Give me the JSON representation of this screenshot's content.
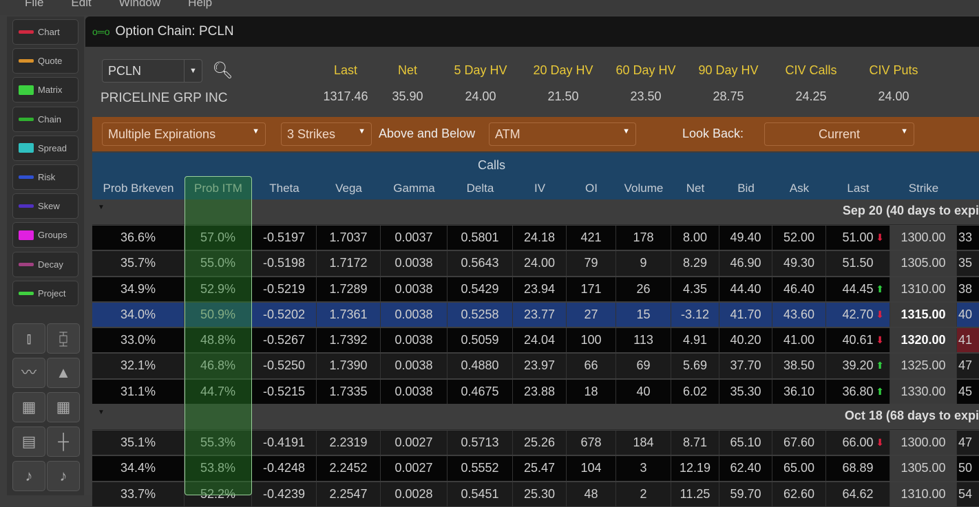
{
  "menu": [
    "File",
    "Edit",
    "Window",
    "Help"
  ],
  "sidebar": {
    "items": [
      {
        "label": "Chart",
        "icon": "chart-icon",
        "color": "#d02840"
      },
      {
        "label": "Quote",
        "icon": "quote-icon",
        "color": "#d8902a"
      },
      {
        "label": "Matrix",
        "icon": "matrix-icon",
        "color": "#3cd040"
      },
      {
        "label": "Chain",
        "icon": "chain-icon",
        "color": "#30b030"
      },
      {
        "label": "Spread",
        "icon": "spread-icon",
        "color": "#30c0c0"
      },
      {
        "label": "Risk",
        "icon": "risk-icon",
        "color": "#3050d0"
      },
      {
        "label": "Skew",
        "icon": "skew-icon",
        "color": "#5030c0"
      },
      {
        "label": "Groups",
        "icon": "groups-icon",
        "color": "#e020e0"
      },
      {
        "label": "Decay",
        "icon": "decay-icon",
        "color": "#a04080"
      },
      {
        "label": "Project",
        "icon": "project-icon",
        "color": "#40d040"
      }
    ]
  },
  "window": {
    "title": "Option Chain: PCLN"
  },
  "symbol": {
    "value": "PCLN",
    "company": "PRICELINE GRP INC"
  },
  "quote": {
    "headers": [
      "Last",
      "Net",
      "5 Day HV",
      "20 Day HV",
      "60 Day HV",
      "90 Day HV",
      "CIV Calls",
      "CIV Puts"
    ],
    "values": [
      "1317.46",
      "35.90",
      "24.00",
      "21.50",
      "23.50",
      "28.75",
      "24.25",
      "24.00"
    ]
  },
  "filters": {
    "expirations": "Multiple Expirations",
    "strikes": "3 Strikes",
    "above_below_label": "Above and Below",
    "atm": "ATM",
    "lookback_label": "Look Back:",
    "lookback": "Current"
  },
  "table": {
    "section": "Calls",
    "columns": [
      "Prob Brkeven",
      "Prob ITM",
      "Theta",
      "Vega",
      "Gamma",
      "Delta",
      "IV",
      "OI",
      "Volume",
      "Net",
      "Bid",
      "Ask",
      "Last",
      "Strike"
    ],
    "groups": [
      {
        "label": "Sep 20 (40 days to expi",
        "rows": [
          {
            "cells": [
              "36.6%",
              "57.0%",
              "-0.5197",
              "1.7037",
              "0.0037",
              "0.5801",
              "24.18",
              "421",
              "178",
              "8.00",
              "49.40",
              "52.00",
              "51.00",
              "1300.00",
              "33"
            ],
            "tick": "down"
          },
          {
            "cells": [
              "35.7%",
              "55.0%",
              "-0.5198",
              "1.7172",
              "0.0038",
              "0.5643",
              "24.00",
              "79",
              "9",
              "8.29",
              "46.90",
              "49.30",
              "51.50",
              "1305.00",
              "35"
            ],
            "tick": ""
          },
          {
            "cells": [
              "34.9%",
              "52.9%",
              "-0.5219",
              "1.7289",
              "0.0038",
              "0.5429",
              "23.94",
              "171",
              "26",
              "4.35",
              "44.40",
              "46.40",
              "44.45",
              "1310.00",
              "38"
            ],
            "tick": "up"
          },
          {
            "cells": [
              "34.0%",
              "50.9%",
              "-0.5202",
              "1.7361",
              "0.0038",
              "0.5258",
              "23.77",
              "27",
              "15",
              "-3.12",
              "41.70",
              "43.60",
              "42.70",
              "1315.00",
              "40"
            ],
            "tick": "down",
            "selected": true
          },
          {
            "cells": [
              "33.0%",
              "48.8%",
              "-0.5267",
              "1.7392",
              "0.0038",
              "0.5059",
              "24.04",
              "100",
              "113",
              "4.91",
              "40.20",
              "41.00",
              "40.61",
              "1320.00",
              "41"
            ],
            "tick": "down"
          },
          {
            "cells": [
              "32.1%",
              "46.8%",
              "-0.5250",
              "1.7390",
              "0.0038",
              "0.4880",
              "23.97",
              "66",
              "69",
              "5.69",
              "37.70",
              "38.50",
              "39.20",
              "1325.00",
              "47"
            ],
            "tick": "up"
          },
          {
            "cells": [
              "31.1%",
              "44.7%",
              "-0.5215",
              "1.7335",
              "0.0038",
              "0.4675",
              "23.88",
              "18",
              "40",
              "6.02",
              "35.30",
              "36.10",
              "36.80",
              "1330.00",
              "45"
            ],
            "tick": "up"
          }
        ]
      },
      {
        "label": "Oct 18 (68 days to expi",
        "rows": [
          {
            "cells": [
              "35.1%",
              "55.3%",
              "-0.4191",
              "2.2319",
              "0.0027",
              "0.5713",
              "25.26",
              "678",
              "184",
              "8.71",
              "65.10",
              "67.60",
              "66.00",
              "1300.00",
              "47"
            ],
            "tick": "down"
          },
          {
            "cells": [
              "34.4%",
              "53.8%",
              "-0.4248",
              "2.2452",
              "0.0027",
              "0.5552",
              "25.47",
              "104",
              "3",
              "12.19",
              "62.40",
              "65.00",
              "68.89",
              "1305.00",
              "50"
            ],
            "tick": ""
          },
          {
            "cells": [
              "33.7%",
              "52.2%",
              "-0.4239",
              "2.2547",
              "0.0028",
              "0.5451",
              "25.30",
              "48",
              "2",
              "11.25",
              "59.70",
              "62.60",
              "64.62",
              "1310.00",
              "54"
            ],
            "tick": ""
          }
        ]
      }
    ]
  },
  "colors": {
    "up": "#30d040",
    "down": "#e02040",
    "selected": "#1e3a78",
    "accent": "#e8c838"
  }
}
